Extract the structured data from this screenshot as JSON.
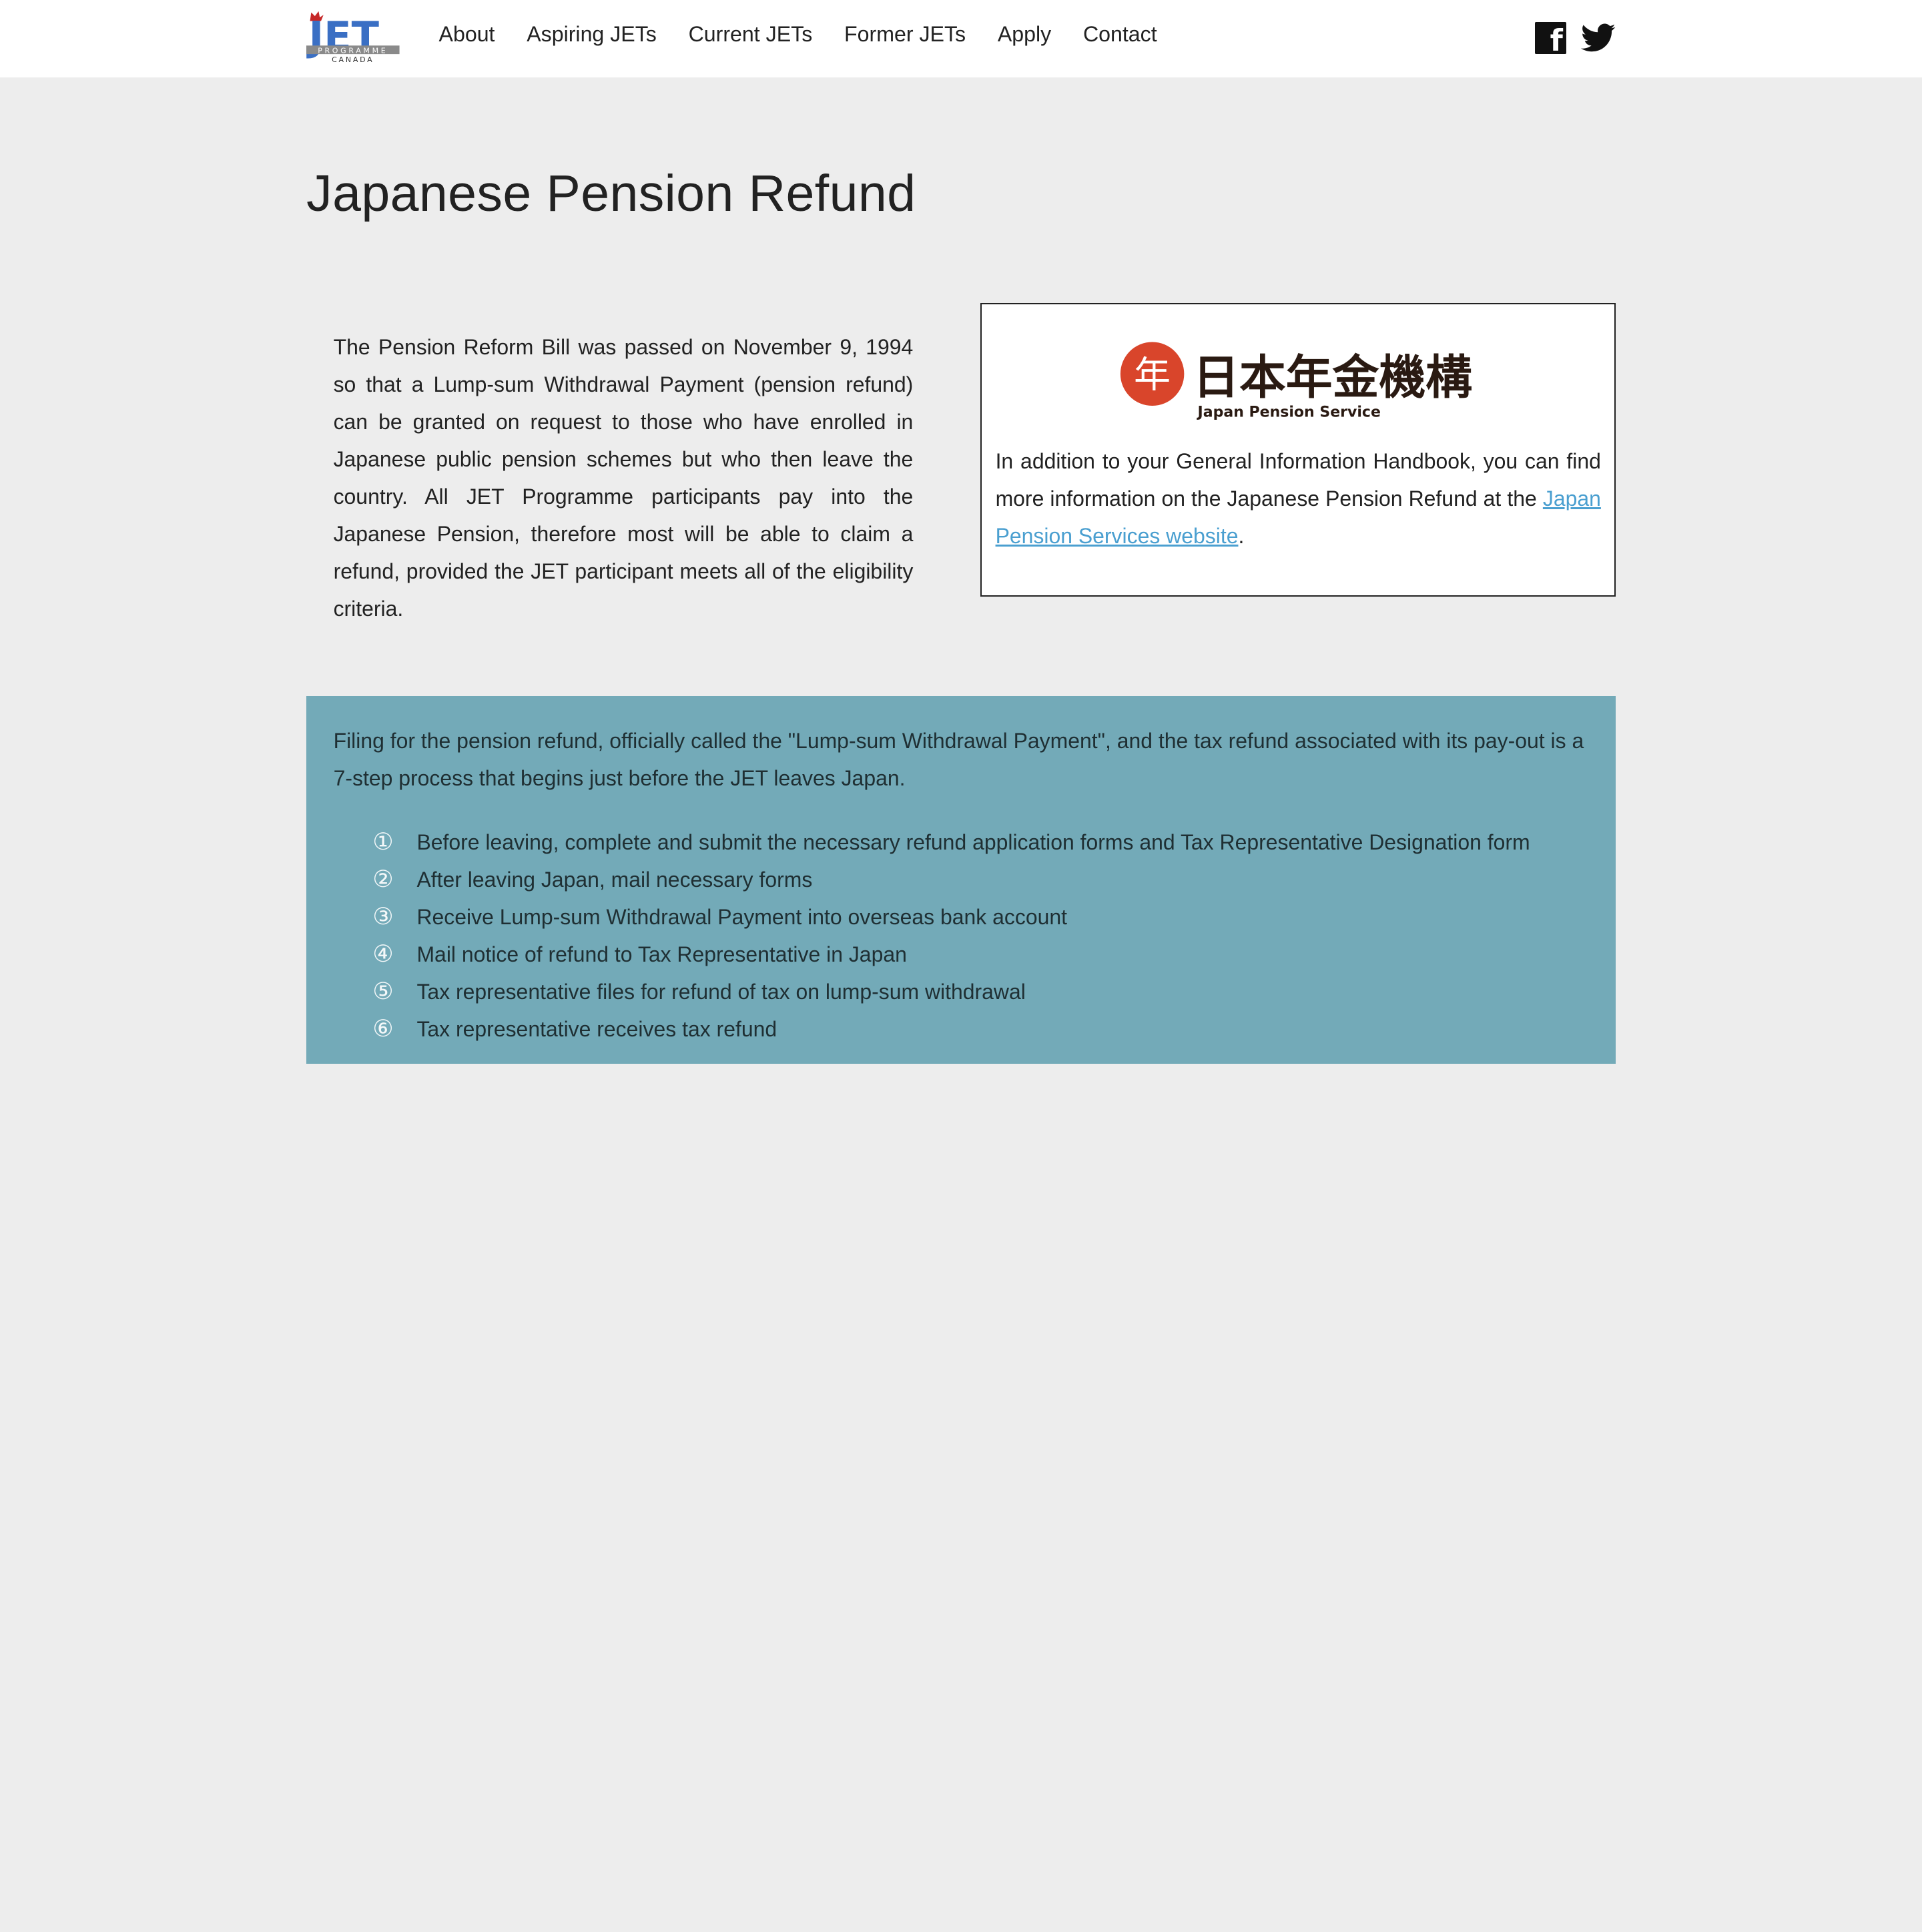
{
  "navbar": {
    "logo_text": "JET",
    "logo_subtext": "PROGRAMME",
    "logo_country": "CANADA",
    "links": [
      "About",
      "Aspiring JETs",
      "Current JETs",
      "Former JETs",
      "Apply",
      "Contact"
    ],
    "social_icons": [
      "facebook-icon",
      "twitter-icon"
    ]
  },
  "main": {
    "title": "Japanese Pension Refund",
    "intro": "The Pension Reform Bill was passed on November 9, 1994 so that a Lump-sum Withdrawal Payment (pension refund) can be granted on request to those who have enrolled in Japanese public pension schemes but who then leave the country. All JET Programme participants pay into the Japanese Pension, therefore most will be able to claim a refund, provided the JET participant meets all of the eligibility criteria."
  },
  "info_box": {
    "logo_kanji": "日本年金機構",
    "logo_english": "Japan Pension Service",
    "logo_seal": "年",
    "text_before": "In addition to your General Information Handbook, you can find more information on the Japanese Pension Refund at the ",
    "link_text": "Japan Pension Services website",
    "text_after": "."
  },
  "steps": {
    "intro": "Filing for the pension refund, officially called the \"Lump-sum Withdrawal Payment\", and the tax refund associated with its pay-out is a 7-step process that begins just before the JET leaves Japan.",
    "items": [
      {
        "num": "①",
        "text": "Before leaving, complete and submit the necessary refund application forms and Tax Representative Designation form"
      },
      {
        "num": "②",
        "text": "After leaving Japan, mail necessary forms"
      },
      {
        "num": "③",
        "text": "Receive Lump-sum Withdrawal Payment into overseas bank account"
      },
      {
        "num": "④",
        "text": "Mail notice of refund to Tax Representative in Japan"
      },
      {
        "num": "⑤",
        "text": "Tax representative files for refund of tax on lump-sum withdrawal"
      },
      {
        "num": "⑥",
        "text": "Tax representative receives tax refund"
      }
    ]
  },
  "colors": {
    "nav_bg": "#ffffff",
    "page_bg": "#ededed",
    "panel_bg": "#73aab8",
    "link": "#4a9fd0",
    "logo_blue": "#3a6fc4",
    "seal_red": "#d9452b"
  }
}
